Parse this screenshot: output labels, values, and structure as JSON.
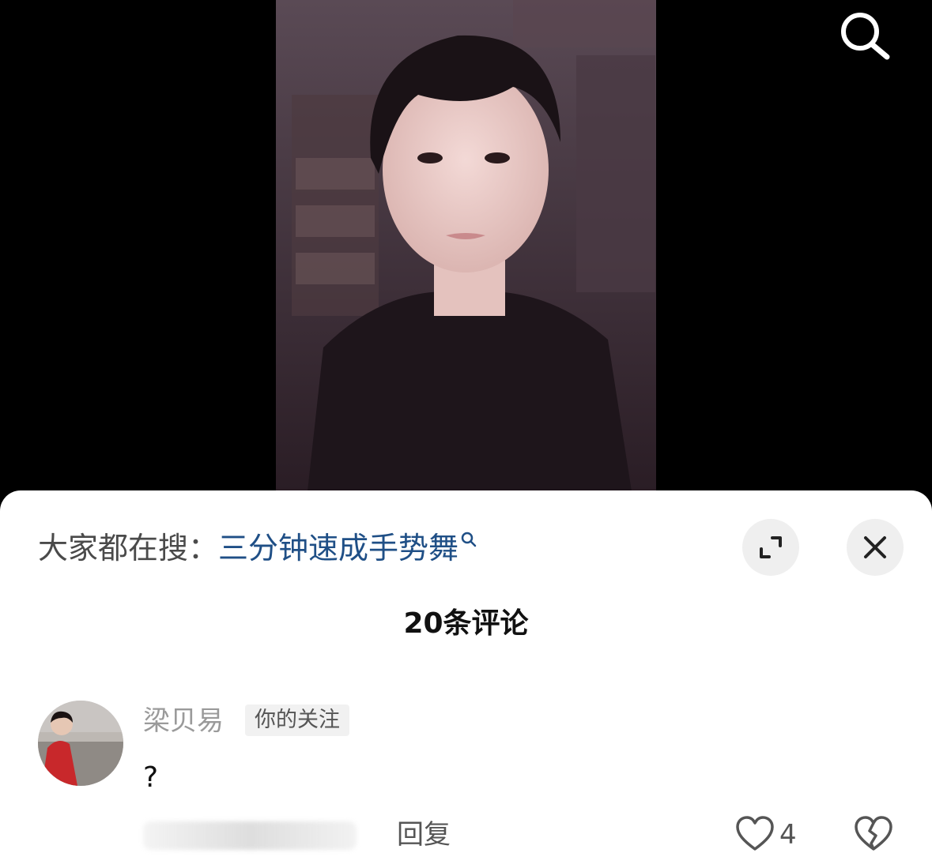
{
  "trending": {
    "prefix": "大家都在搜：",
    "query": "三分钟速成手势舞"
  },
  "comments_header": {
    "count_label": "20条评论"
  },
  "comment": {
    "username": "梁贝易",
    "follow_tag": "你的关注",
    "text": "?",
    "reply_label": "回复",
    "like_count": "4"
  },
  "icons": {
    "search": "search-icon",
    "expand": "expand-icon",
    "close": "close-icon",
    "like": "heart-icon",
    "dislike": "broken-heart-icon"
  },
  "colors": {
    "link": "#1f4f86",
    "sheet_bg": "#ffffff",
    "video_bg": "#000000"
  }
}
